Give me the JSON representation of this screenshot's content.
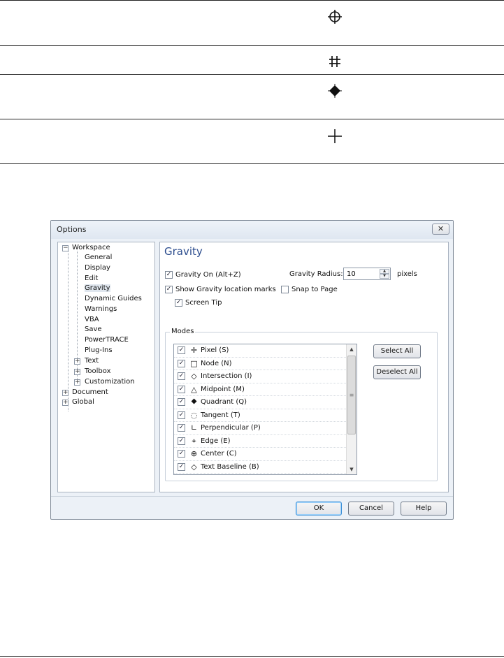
{
  "symbols": {
    "row1": "⊕",
    "row2": "#",
    "row3": "◆",
    "row4": "+"
  },
  "dialog": {
    "title": "Options",
    "close": "✕",
    "tree": [
      {
        "label": "Workspace",
        "expander": "−"
      },
      {
        "label": "General"
      },
      {
        "label": "Display"
      },
      {
        "label": "Edit"
      },
      {
        "label": "Gravity"
      },
      {
        "label": "Dynamic Guides"
      },
      {
        "label": "Warnings"
      },
      {
        "label": "VBA"
      },
      {
        "label": "Save"
      },
      {
        "label": "PowerTRACE"
      },
      {
        "label": "Plug-Ins"
      },
      {
        "label": "Text",
        "expander": "+"
      },
      {
        "label": "Toolbox",
        "expander": "+"
      },
      {
        "label": "Customization",
        "expander": "+"
      },
      {
        "label": "Document",
        "expander": "+"
      },
      {
        "label": "Global",
        "expander": "+"
      }
    ],
    "heading": "Gravity",
    "gravity_on": {
      "label": "Gravity On (Alt+Z)",
      "checked": "✓"
    },
    "show_marks": {
      "label": "Show Gravity location marks",
      "checked": "✓"
    },
    "screen_tip": {
      "label": "Screen Tip",
      "checked": "✓"
    },
    "snap_to_page": {
      "label": "Snap to Page",
      "checked": ""
    },
    "radius": {
      "label": "Gravity Radius:",
      "value": "10",
      "unit": "pixels",
      "up": "▲",
      "down": "▼"
    },
    "modes": {
      "title": "Modes",
      "items": [
        {
          "icon": "✛",
          "label": "Pixel (S)",
          "checked": "✓"
        },
        {
          "icon": "□",
          "label": "Node (N)",
          "checked": "✓"
        },
        {
          "icon": "◇",
          "label": "Intersection (I)",
          "checked": "✓"
        },
        {
          "icon": "△",
          "label": "Midpoint (M)",
          "checked": "✓"
        },
        {
          "icon": "⯁",
          "label": "Quadrant (Q)",
          "checked": "✓"
        },
        {
          "icon": "◌",
          "label": "Tangent (T)",
          "checked": "✓"
        },
        {
          "icon": "∟",
          "label": "Perpendicular (P)",
          "checked": "✓"
        },
        {
          "icon": "⌖",
          "label": "Edge (E)",
          "checked": "✓"
        },
        {
          "icon": "⊕",
          "label": "Center (C)",
          "checked": "✓"
        },
        {
          "icon": "◇",
          "label": "Text Baseline (B)",
          "checked": "✓"
        }
      ],
      "scroll_up": "▲",
      "scroll_down": "▼",
      "scroll_grip": "≡"
    },
    "buttons": {
      "select_all": "Select All",
      "deselect_all": "Deselect All",
      "ok": "OK",
      "cancel": "Cancel",
      "help": "Help"
    }
  }
}
